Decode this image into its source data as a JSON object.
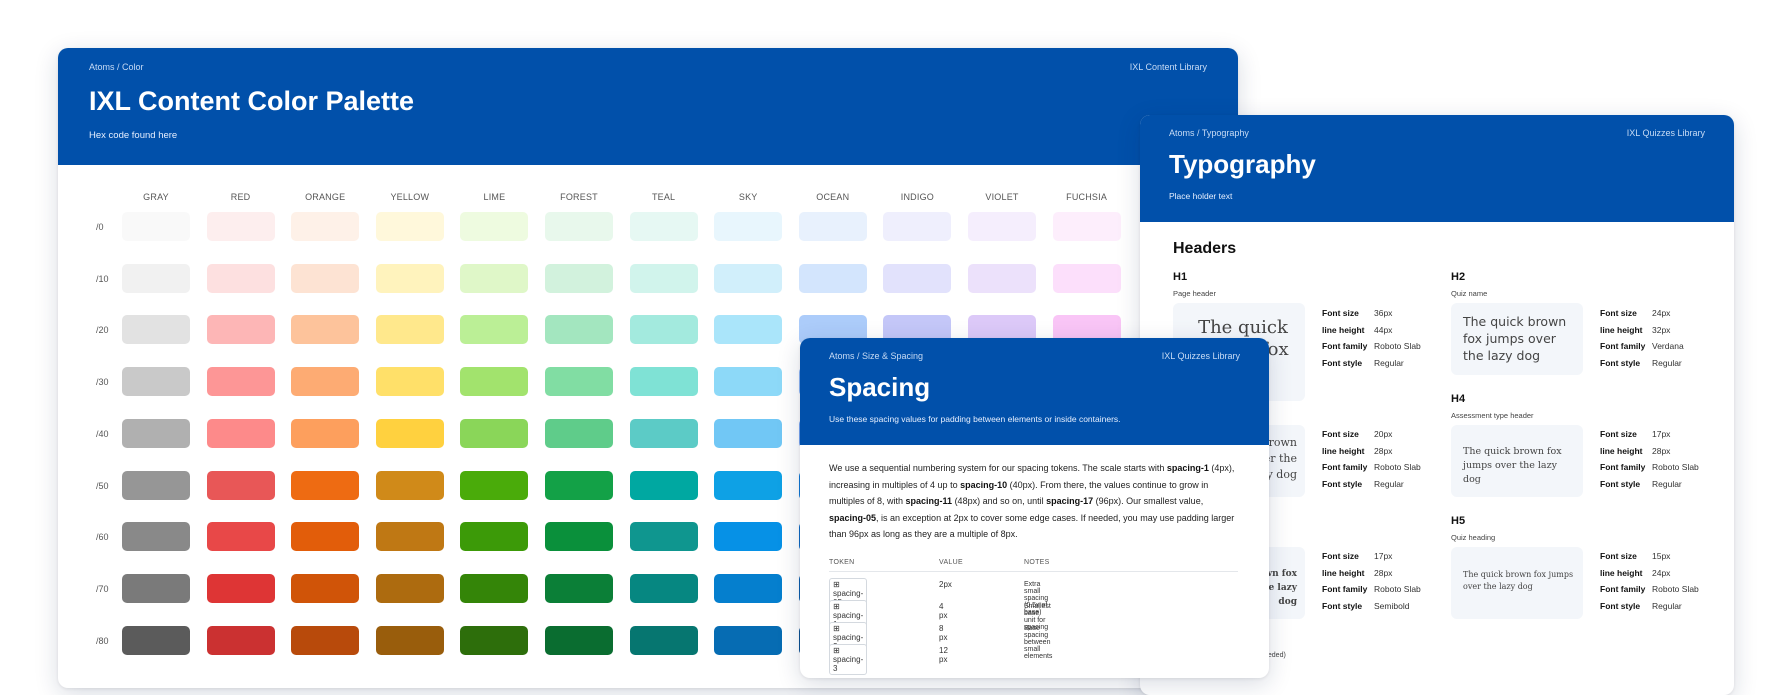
{
  "palette": {
    "breadcrumb": "Atoms / Color",
    "library": "IXL Content Library",
    "title": "IXL Content Color Palette",
    "subtitle_prefix": "Hex code found ",
    "subtitle_link": "here",
    "columns": [
      "GRAY",
      "RED",
      "ORANGE",
      "YELLOW",
      "LIME",
      "FOREST",
      "TEAL",
      "SKY",
      "OCEAN",
      "INDIGO",
      "VIOLET",
      "FUCHSIA"
    ],
    "rows": [
      "/0",
      "/10",
      "/20",
      "/30",
      "/40",
      "/50",
      "/60",
      "/70",
      "/80"
    ],
    "colors": [
      [
        "#f9f9f9",
        "#fdeeee",
        "#fef1e8",
        "#fff8db",
        "#eefbe0",
        "#e8f8ec",
        "#e6f8f3",
        "#e8f6fd",
        "#e8f1fd",
        "#efeffd",
        "#f5eefd",
        "#fdeefc"
      ],
      [
        "#f1f1f1",
        "#fde0e0",
        "#fde3d3",
        "#fff3bd",
        "#dff7c8",
        "#d2f2dd",
        "#d1f4ec",
        "#d1effb",
        "#d3e5fd",
        "#e2e2fc",
        "#ece1fb",
        "#fcdffb"
      ],
      [
        "#e2e2e2",
        "#fdb6b6",
        "#fdc39b",
        "#ffe88c",
        "#bbef96",
        "#a3e6bf",
        "#a3eade",
        "#aae5fa",
        "#acccfa",
        "#c4c7f8",
        "#dcc9f8",
        "#f9c5f6"
      ],
      [
        "#c9c9c9",
        "#fd9696",
        "#fdab73",
        "#ffe069",
        "#a2e36d",
        "#81dda3",
        "#7fe2d5",
        "#8dd9f8",
        "#8fb8f6",
        "#aab0f3",
        "#c8aef4",
        "#f5a8f1"
      ],
      [
        "#b0b0b0",
        "#fd8a8a",
        "#fd9f5d",
        "#ffd13f",
        "#8ad659",
        "#5fcc8a",
        "#5ccbc6",
        "#71c7f5",
        "#79a7f1",
        "#9299ec",
        "#b593ee",
        "#ef8cea"
      ],
      [
        "#969696",
        "#e85757",
        "#ee6b12",
        "#d08a19",
        "#4aab0a",
        "#13a147",
        "#00a8a1",
        "#0ea1e5",
        "#0f79d7",
        "#5860d9",
        "#8c55d7",
        "#d24ac9"
      ],
      [
        "#898989",
        "#e84848",
        "#e25d0a",
        "#bf7814",
        "#3c9a08",
        "#0a903b",
        "#0f968f",
        "#0691e6",
        "#0c6bc5",
        "#4c52c7",
        "#7b47c7",
        "#c03cb5"
      ],
      [
        "#7a7a7a",
        "#de3535",
        "#d05408",
        "#ad6b0f",
        "#348508",
        "#0b7f37",
        "#068781",
        "#057fce",
        "#0a5fae",
        "#4247b0",
        "#6c3db1",
        "#ab339f"
      ],
      [
        "#5b5b5b",
        "#cb3131",
        "#b84a0b",
        "#995d0c",
        "#2d6e0b",
        "#0a6d30",
        "#067670",
        "#066cb3",
        "#0a5293",
        "#383c95",
        "#5b3394",
        "#912b87"
      ]
    ]
  },
  "typography": {
    "breadcrumb": "Atoms / Typography",
    "library": "IXL Quizzes Library",
    "title": "Typography",
    "subtitle": "Place holder text",
    "section": "Headers",
    "blocks": [
      {
        "label": "H1",
        "caption": "Page header",
        "sample": "The quick brown fox",
        "font_size": "36px",
        "line_height": "44px",
        "font_family": "Roboto Slab",
        "font_style": "Regular"
      },
      {
        "label": "H2",
        "caption": "Quiz name",
        "sample": "The quick brown fox jumps over the lazy dog",
        "font_size": "24px",
        "line_height": "32px",
        "font_family": "Verdana",
        "font_style": "Regular"
      },
      {
        "label": "",
        "caption": "",
        "sample": "The quick brown fox jumps over the lazy dog",
        "font_size": "20px",
        "line_height": "28px",
        "font_family": "Roboto Slab",
        "font_style": "Regular"
      },
      {
        "label": "H4",
        "caption": "Assessment type header",
        "sample": "The quick brown fox jumps over the lazy dog",
        "font_size": "17px",
        "line_height": "28px",
        "font_family": "Roboto Slab",
        "font_style": "Regular"
      },
      {
        "label": "",
        "caption": "",
        "sample": "The quick brown fox jumps over the lazy dog",
        "font_size": "17px",
        "line_height": "28px",
        "font_family": "Roboto Slab",
        "font_style": "Semibold"
      },
      {
        "label": "H5",
        "caption": "Quiz heading",
        "sample": "The quick brown fox jumps over the lazy dog",
        "font_size": "15px",
        "line_height": "24px",
        "font_family": "Roboto Slab",
        "font_style": "Regular"
      }
    ],
    "spec_keys": {
      "font_size": "Font size",
      "line_height": "line height",
      "font_family": "Font family",
      "font_style": "Font style"
    },
    "footer_fragment": "eeded)"
  },
  "spacing": {
    "breadcrumb": "Atoms / Size & Spacing",
    "library": "IXL Quizzes Library",
    "title": "Spacing",
    "subtitle": "Use these spacing values for padding between elements or inside containers.",
    "intro": [
      {
        "t": "We use a sequential numbering system for our spacing tokens. The scale starts with ",
        "b": false
      },
      {
        "t": "spacing-1",
        "b": true
      },
      {
        "t": " (4px), increasing in multiples of 4 up to ",
        "b": false
      },
      {
        "t": "spacing-10",
        "b": true
      },
      {
        "t": " (40px). From there, the values continue to grow in multiples of 8, with ",
        "b": false
      },
      {
        "t": "spacing-11",
        "b": true
      },
      {
        "t": " (48px) and so on, until ",
        "b": false
      },
      {
        "t": "spacing-17",
        "b": true
      },
      {
        "t": " (96px). Our smallest value, ",
        "b": false
      },
      {
        "t": "spacing-05",
        "b": true
      },
      {
        "t": ", is an exception at 2px to cover some edge cases. If needed, you may use padding larger than 96px as long as they are a multiple of 8px.",
        "b": false
      }
    ],
    "headers": {
      "token": "TOKEN",
      "value": "VALUE",
      "notes": "NOTES"
    },
    "rows": [
      {
        "token": "spacing-05",
        "value": "2px",
        "notes": "Extra small spacing (0.5x of base)"
      },
      {
        "token": "spacing-1",
        "value": "4 px",
        "notes": "Smallest base unit for spacing"
      },
      {
        "token": "spacing-2",
        "value": "8 px",
        "notes": "Base spacing between small elements"
      },
      {
        "token": "spacing-3",
        "value": "12 px",
        "notes": ""
      }
    ]
  }
}
